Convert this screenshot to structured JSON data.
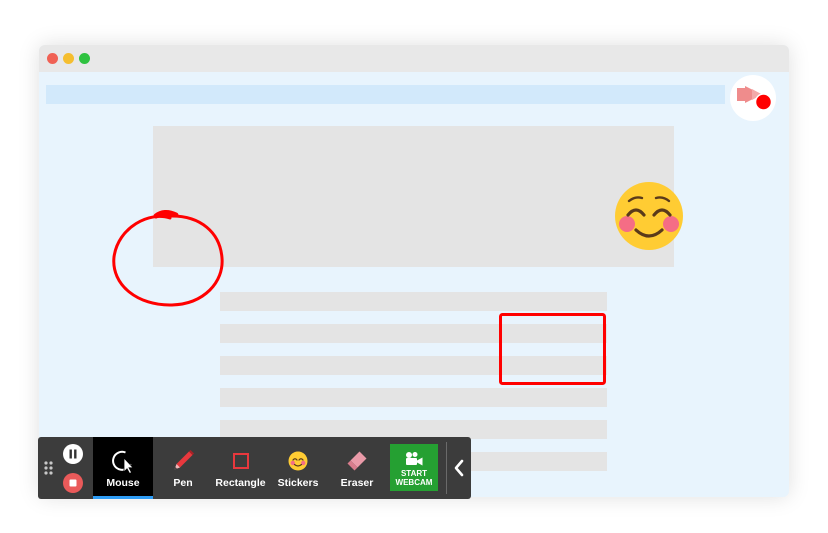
{
  "toolbar": {
    "tools": [
      {
        "label": "Mouse",
        "icon": "mouse-cursor-icon",
        "active": true
      },
      {
        "label": "Pen",
        "icon": "pen-icon"
      },
      {
        "label": "Rectangle",
        "icon": "rectangle-icon"
      },
      {
        "label": "Stickers",
        "icon": "smiley-icon"
      },
      {
        "label": "Eraser",
        "icon": "eraser-icon"
      }
    ],
    "webcam_label": "START\nWEBCAM",
    "controls": [
      "pause-icon",
      "stop-icon",
      "drag-handle-icon",
      "chevron-left-icon"
    ]
  },
  "colors": {
    "annotation": "#ff0000",
    "toolbar_bg": "#3c3c3c",
    "active_tool_bg": "#000000",
    "active_underline": "#2e9cf5",
    "webcam_button": "#25a032",
    "page_bg": "#e8f4fd"
  },
  "annotations": [
    "circle-drawing",
    "rectangle-drawing",
    "smiling-face-sticker"
  ]
}
